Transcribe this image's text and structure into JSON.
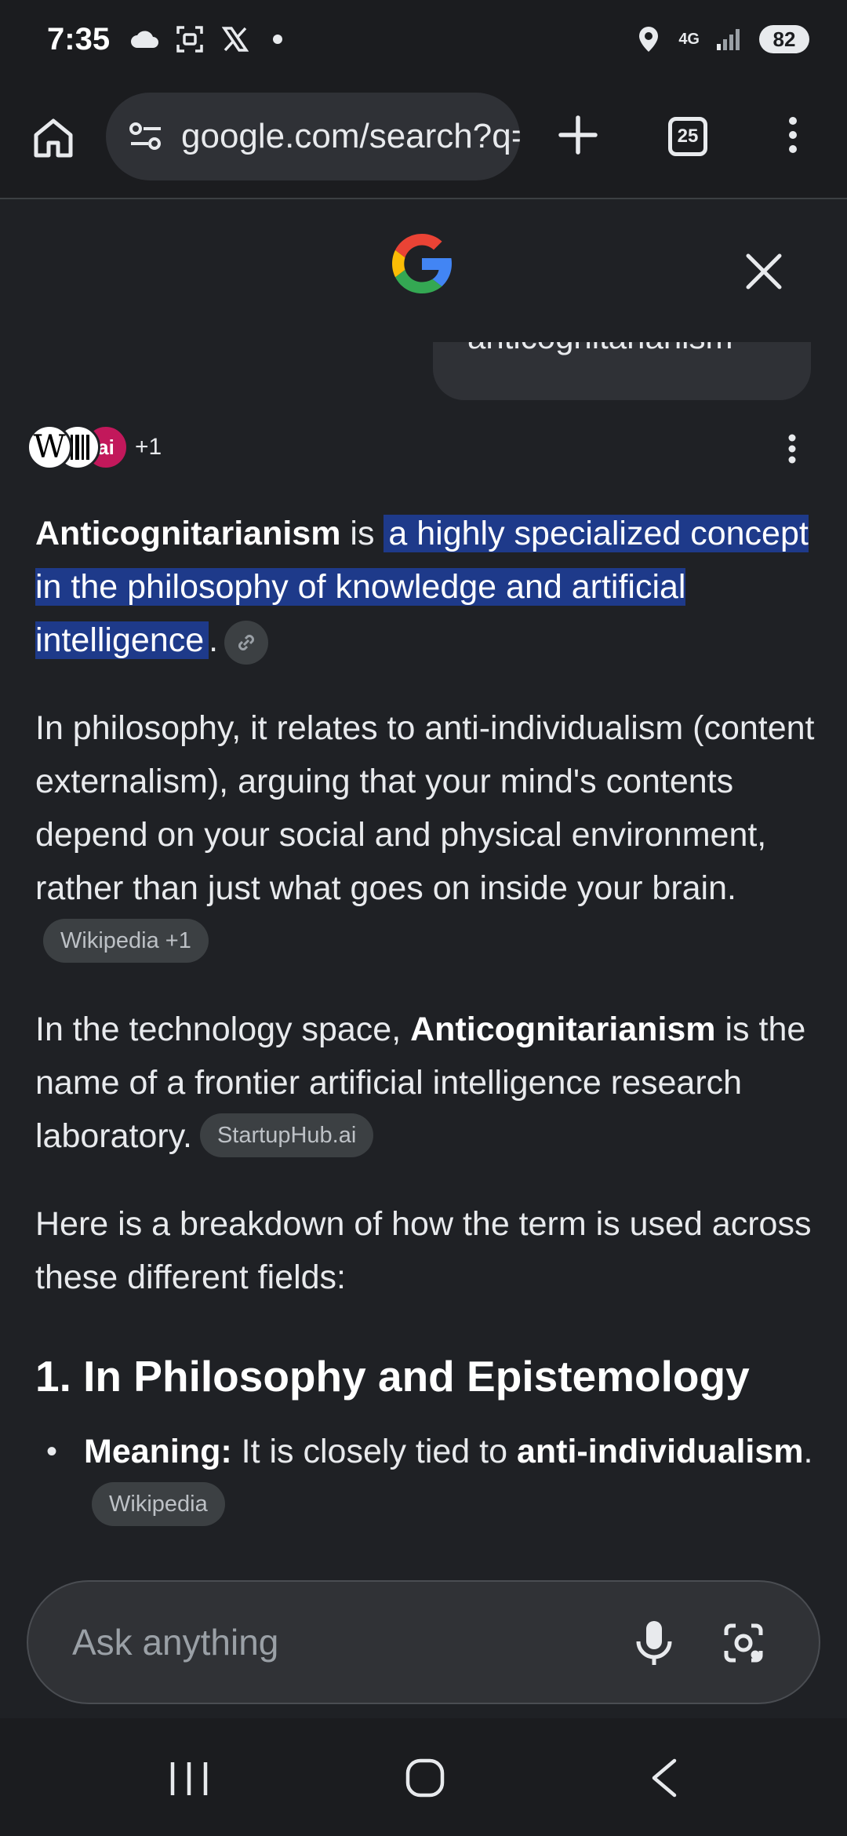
{
  "status_bar": {
    "time": "7:35",
    "network": "4G",
    "battery": "82",
    "icons": [
      "cloud-icon",
      "screenshot-icon",
      "x-logo-icon",
      "notification-dot",
      "location-icon",
      "signal-icon"
    ]
  },
  "toolbar": {
    "url": "google.com/search?q=anticognitarianism",
    "tab_count": "25"
  },
  "search": {
    "query": "anticognitarianism"
  },
  "sources": {
    "more": "+1",
    "items": [
      {
        "icon": "W"
      },
      {
        "icon": "bars-logo"
      },
      {
        "icon": "ai"
      }
    ]
  },
  "answer": {
    "p1_term": "Anticognitarianism",
    "p1_is": " is ",
    "p1_highlight": "a highly specialized concept in the philosophy of knowledge and artificial intelligence",
    "p1_end": ".",
    "p2_text": "In philosophy, it relates to anti-individualism (content externalism), arguing that your mind's contents depend on your social and physical environment, rather than just what goes on inside your brain.",
    "p2_cite": "Wikipedia +1",
    "p3_pre": "In the technology space, ",
    "p3_term": "Anticognitarianism",
    "p3_post": " is the name of a frontier artificial intelligence research laboratory.",
    "p3_cite": "StartupHub.ai",
    "p4_text": "Here is a breakdown of how the term is used across these different fields:",
    "section_heading": "1. In Philosophy and Epistemology",
    "bullet_label": "Meaning:",
    "bullet_text": " It is closely tied to ",
    "bullet_bold": "anti-individualism",
    "bullet_end": ".",
    "bullet_cite": "Wikipedia"
  },
  "ask": {
    "placeholder": "Ask anything"
  },
  "colors": {
    "background": "#1f2125",
    "highlight": "#1e3a8a",
    "chip": "#3c4043"
  }
}
